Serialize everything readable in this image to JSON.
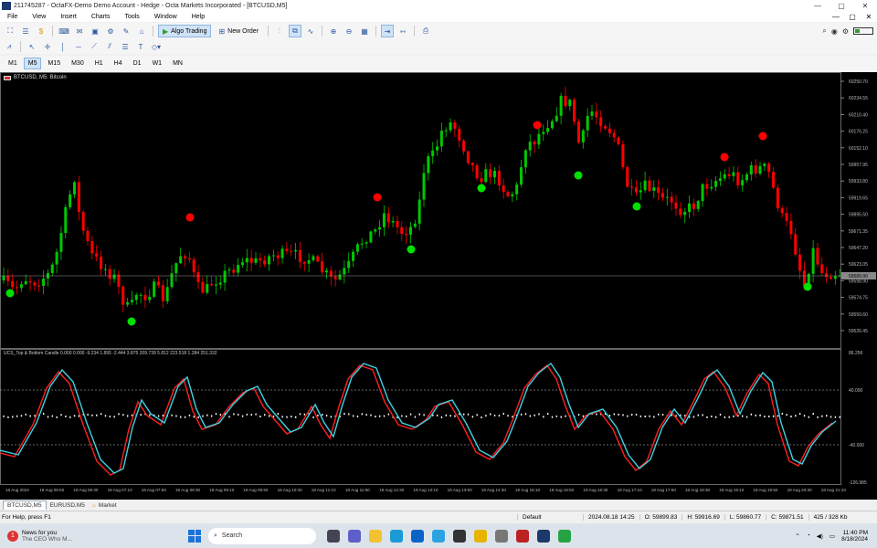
{
  "window": {
    "title": "211745287 - OctaFX-Demo Demo Account - Hedge - Octa Markets Incorporated - [BTCUSD,M5]",
    "controls": [
      "—",
      "▢",
      "✕"
    ]
  },
  "menu": [
    "File",
    "View",
    "Insert",
    "Charts",
    "Tools",
    "Window",
    "Help"
  ],
  "menu_controls": [
    "—",
    "▢",
    "✕"
  ],
  "toolbar": {
    "algo": "Algo Trading",
    "new_order": "New Order"
  },
  "timeframes": [
    "M1",
    "M5",
    "M15",
    "M30",
    "H1",
    "H4",
    "D1",
    "W1",
    "MN"
  ],
  "active_timeframe": "M5",
  "chart": {
    "symbol_label": "BTCUSD, M5:  Bitcoin",
    "indicator_label": "UCS_Top & Bottom Candle 0.000 0.000 -9.234 1.895 -2.444 3.875 209.739 5.812 223.518 1.284 251.332",
    "price_ticks": [
      "60250.70",
      "60234.55",
      "60210.40",
      "60176.25",
      "60152.10",
      "59957.95",
      "59933.80",
      "59919.65",
      "59895.50",
      "59671.35",
      "59647.20",
      "59623.05",
      "59598.90",
      "59574.75",
      "59550.60",
      "59526.45"
    ],
    "current_price": "59589.90",
    "indicator_ticks": [
      "86.256",
      "40.000",
      "-40.000",
      "-126.985"
    ],
    "time_ticks": [
      "18 Aug 2024",
      "18 Aug 05:50",
      "18 Aug 06:30",
      "18 Aug 07:10",
      "18 Aug 07:50",
      "18 Aug 08:30",
      "18 Aug 09:10",
      "18 Aug 09:50",
      "18 Aug 10:30",
      "18 Aug 11:10",
      "18 Aug 11:50",
      "18 Aug 12:30",
      "18 Aug 13:10",
      "18 Aug 13:50",
      "18 Aug 14:30",
      "18 Aug 15:10",
      "18 Aug 15:50",
      "18 Aug 16:30",
      "18 Aug 17:10",
      "18 Aug 17:50",
      "18 Aug 18:30",
      "18 Aug 19:10",
      "18 Aug 19:50",
      "18 Aug 20:30",
      "18 Aug 21:10"
    ],
    "colors": {
      "bull": "#00c800",
      "bear": "#ff0000",
      "signal_top": "#ff0000",
      "signal_bottom": "#00e000",
      "osc_fast": "#ff2020",
      "osc_slow": "#40d0e0"
    }
  },
  "tabs": [
    "BTCUSD,M5",
    "EURUSD,M5",
    "Market"
  ],
  "active_tab": "BTCUSD,M5",
  "status": {
    "help": "For Help, press F1",
    "profile": "Default",
    "datetime": "2024.08.18 14:25",
    "open": "O: 59899.83",
    "high": "H: 59916.69",
    "low": "L: 59860.77",
    "close": "C: 59871.51",
    "traffic": "425 / 328 Kb"
  },
  "taskbar": {
    "news_title": "News for you",
    "news_sub": "The CEO Who M...",
    "search": "Search",
    "time": "11:40 PM",
    "date": "8/18/2024"
  }
}
